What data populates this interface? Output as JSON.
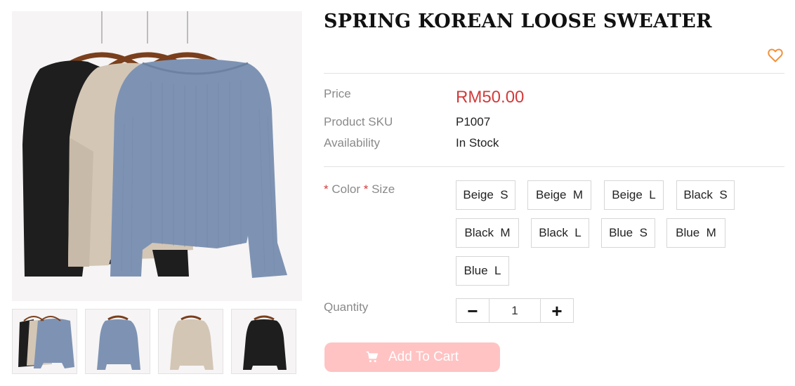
{
  "product": {
    "title": "SPRING KOREAN LOOSE SWEATER",
    "price_label": "Price",
    "price": "RM50.00",
    "sku_label": "Product SKU",
    "sku": "P1007",
    "availability_label": "Availability",
    "availability": "In Stock"
  },
  "options": {
    "required_mark": "*",
    "color_label": "Color",
    "size_label": "Size",
    "variants": [
      "Beige  S",
      "Beige  M",
      "Beige  L",
      "Black  S",
      "Black  M",
      "Black  L",
      "Blue  S",
      "Blue  M",
      "Blue  L"
    ]
  },
  "quantity": {
    "label": "Quantity",
    "value": "1",
    "decrease_symbol": "−",
    "increase_symbol": "+"
  },
  "cart": {
    "add_label": "Add To Cart",
    "icon": "cart-icon"
  },
  "wishlist": {
    "icon": "heart-outline-icon"
  },
  "gallery": {
    "thumbnails": [
      "all colors",
      "blue",
      "beige",
      "black"
    ]
  },
  "colors": {
    "price": "#d33b3b",
    "wishlist": "#f2913a",
    "add_to_cart_bg": "#ffc3c3",
    "sweater_black": "#1e1e1f",
    "sweater_beige": "#d3c6b5",
    "sweater_blue": "#7e93b3",
    "hanger_wood": "#7a3f1c"
  }
}
